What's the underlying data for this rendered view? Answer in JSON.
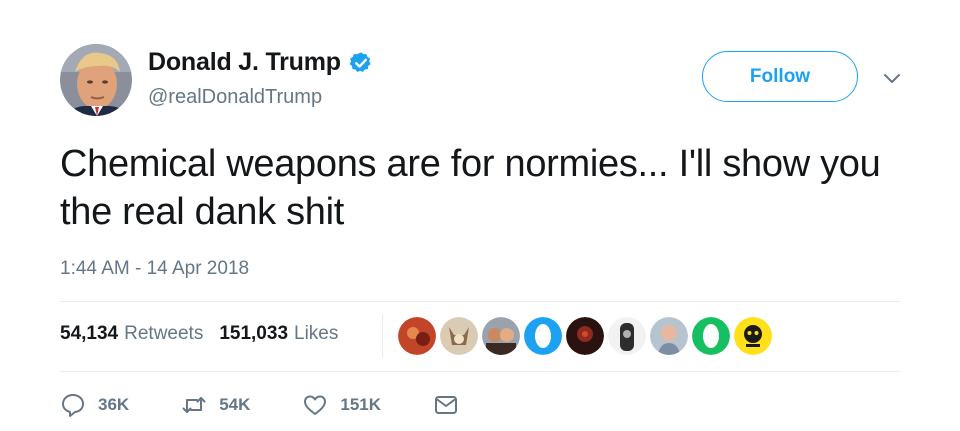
{
  "author": {
    "display_name": "Donald J. Trump",
    "handle": "@realDonaldTrump",
    "verified": true
  },
  "follow_button": {
    "label": "Follow"
  },
  "tweet": {
    "text": "Chemical weapons are for normies... I'll show you the real dank shit",
    "timestamp": "1:44 AM - 14 Apr 2018"
  },
  "stats": {
    "retweets_count": "54,134",
    "retweets_label": "Retweets",
    "likes_count": "151,033",
    "likes_label": "Likes"
  },
  "liker_avatars": [
    "avatar-1",
    "avatar-2",
    "avatar-3",
    "avatar-4",
    "avatar-5",
    "avatar-6",
    "avatar-7",
    "avatar-8",
    "avatar-9"
  ],
  "actions": {
    "reply_count": "36K",
    "retweet_count": "54K",
    "like_count": "151K"
  },
  "colors": {
    "accent": "#1da1f2",
    "text_primary": "#14171a",
    "text_secondary": "#657786",
    "divider": "#e6ecf0"
  }
}
